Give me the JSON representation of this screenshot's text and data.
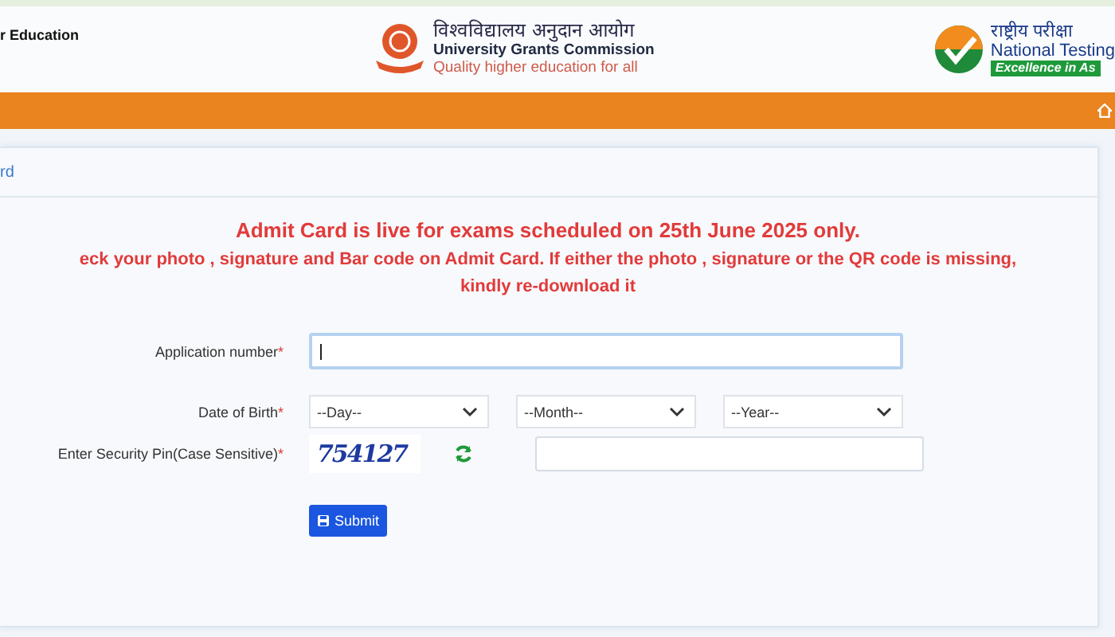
{
  "header": {
    "left_title": "r Education",
    "ugc": {
      "hindi": "विश्वविद्यालय अनुदान आयोग",
      "name": "University Grants Commission",
      "tagline": "Quality higher education for all"
    },
    "nta": {
      "hindi": "राष्ट्रीय परीक्षा",
      "name": "National Testing",
      "tagline": "Excellence in As"
    }
  },
  "panel": {
    "title": "rd"
  },
  "notices": [
    {
      "text": "Admit Card is live for exams scheduled on 25th June 2025 only."
    },
    {
      "text": "eck your photo , signature and Bar code on Admit Card. If either the photo , signature or the QR code is missing, kindly re-download it"
    }
  ],
  "form": {
    "fields": [
      {
        "kind": "text",
        "label": "Application number",
        "required_mark": "*",
        "focused": true
      },
      {
        "kind": "dob",
        "label": "Date of Birth",
        "required_mark": "*",
        "selects": [
          {
            "placeholder": "--Day--"
          },
          {
            "placeholder": "--Month--"
          },
          {
            "placeholder": "--Year--"
          }
        ]
      },
      {
        "kind": "captcha",
        "label": "Enter Security Pin(Case Sensitive)",
        "required_mark": "*",
        "captcha": "754127"
      }
    ],
    "submit": "Submit"
  }
}
